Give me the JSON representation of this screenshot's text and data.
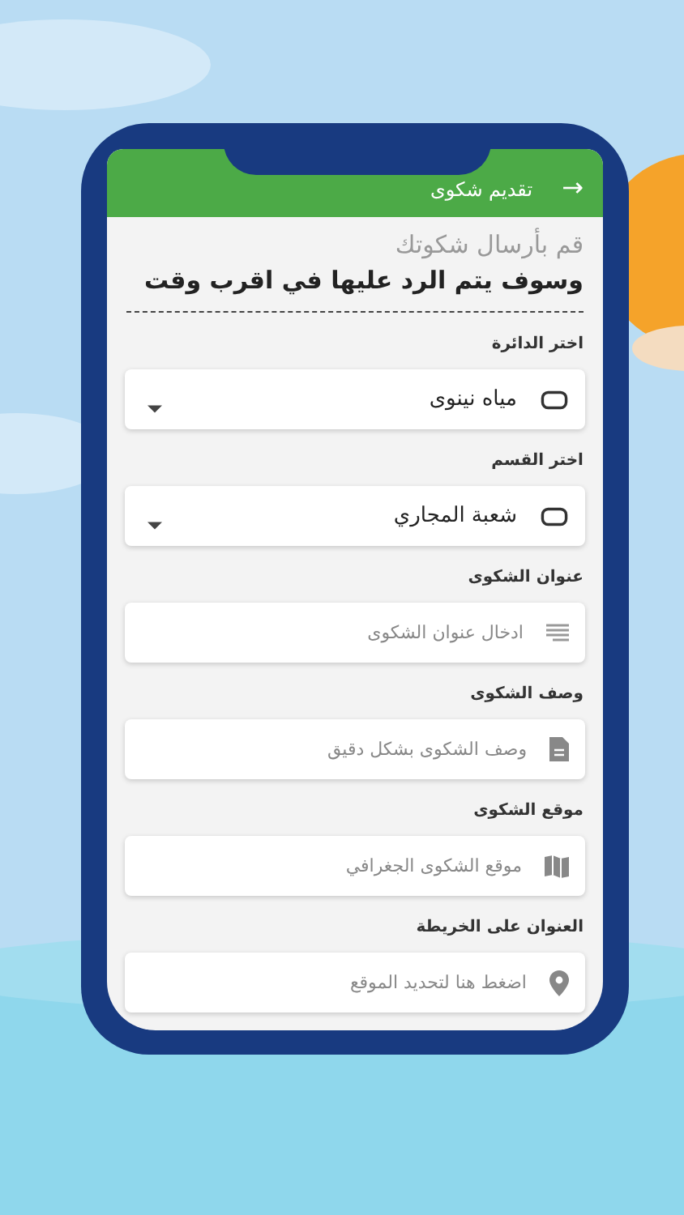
{
  "app_bar": {
    "title": "تقديم شكوى",
    "back": "→"
  },
  "intro": {
    "subtitle": "قم بأرسال شكوتك",
    "headline": "وسوف يتم الرد عليها في اقرب وقت"
  },
  "fields": [
    {
      "kind": "select",
      "label": "اختر الدائرة",
      "value": "مياه نينوى"
    },
    {
      "kind": "select",
      "label": "اختر القسم",
      "value": "شعبة المجاري"
    },
    {
      "kind": "input",
      "label": "عنوان الشكوى",
      "placeholder": "ادخال عنوان الشكوى"
    },
    {
      "kind": "input",
      "label": "وصف الشكوى",
      "placeholder": "وصف الشكوى بشكل دقيق"
    },
    {
      "kind": "input",
      "label": "موقع الشكوى",
      "placeholder": "موقع الشكوى الجغرافي"
    },
    {
      "kind": "input",
      "label": "العنوان على الخريطة",
      "placeholder": "اضغط هنا لتحديد الموقع"
    }
  ]
}
